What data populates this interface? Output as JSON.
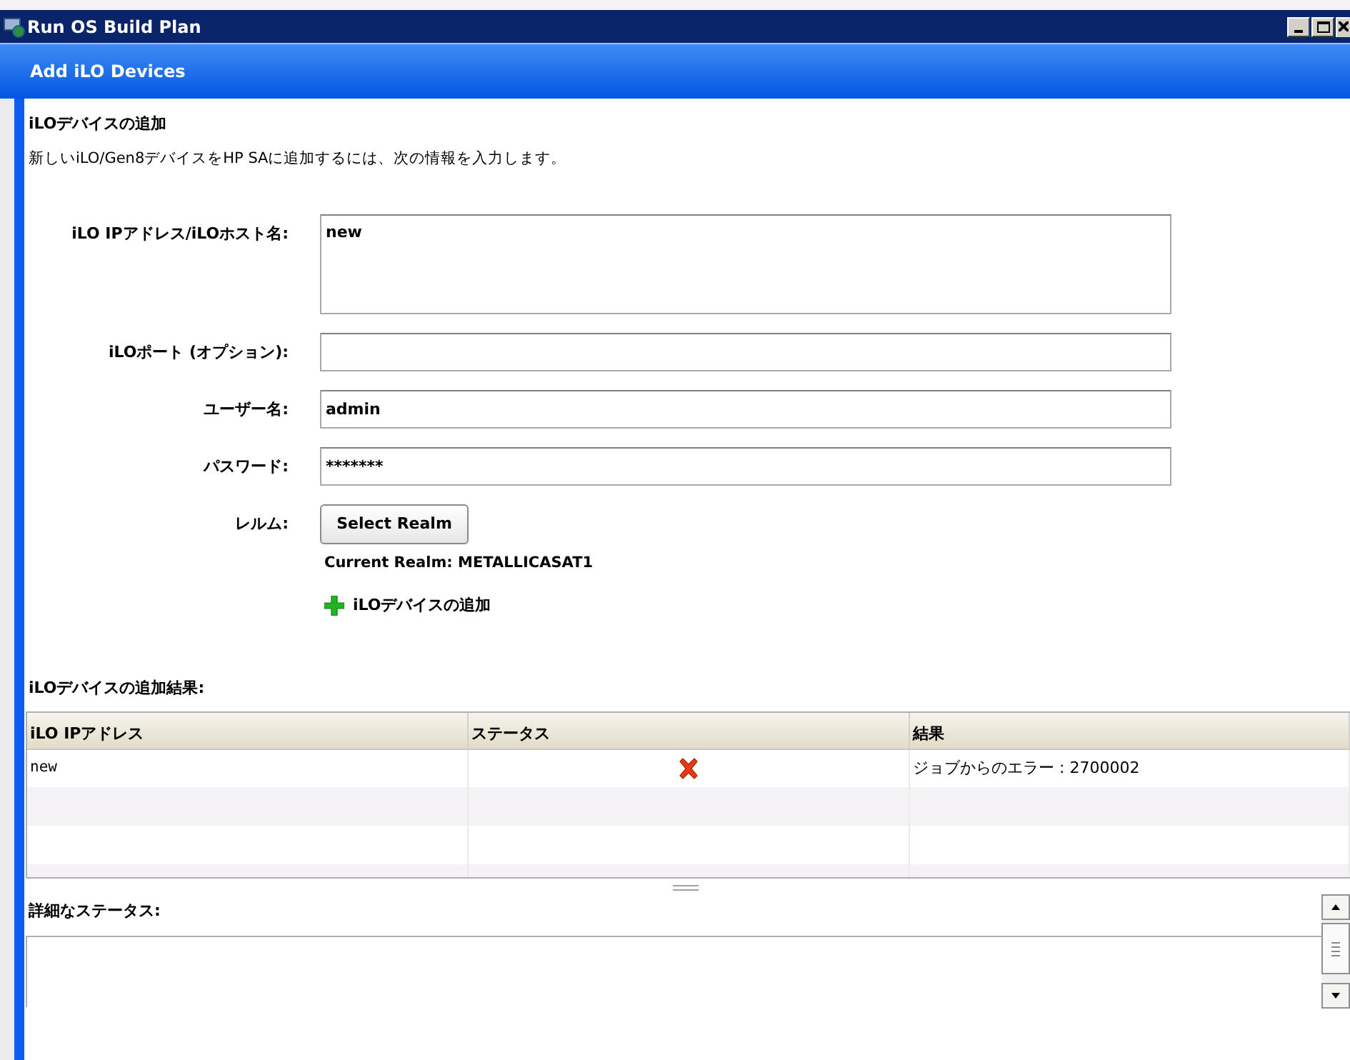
{
  "window": {
    "title": "Run OS Build Plan"
  },
  "header": {
    "title": "Add iLO Devices"
  },
  "section": {
    "title": "iLOデバイスの追加",
    "description": "新しいiLO/Gen8デバイスをHP SAに追加するには、次の情報を入力します。"
  },
  "form": [
    {
      "kind": "textarea",
      "label": "iLO IPアドレス/iLOホスト名:",
      "value": "new"
    },
    {
      "kind": "input",
      "label": "iLOポート (オプション):"
    },
    {
      "kind": "input",
      "label": "ユーザー名:",
      "value": "admin"
    },
    {
      "kind": "input",
      "label": "パスワード:",
      "value": "*******"
    },
    {
      "kind": "button",
      "label": "レルム:",
      "value": "Select Realm"
    }
  ],
  "current_realm": "Current Realm: METALLICASAT1",
  "add_link": "iLOデバイスの追加",
  "results": {
    "title": "iLOデバイスの追加結果:",
    "columns": [
      "iLO IPアドレス",
      "ステータス",
      "結果"
    ],
    "rows": [
      {
        "address": "new",
        "kind": "error",
        "result": "ジョブからのエラー : 2700002"
      }
    ]
  },
  "detail": {
    "label": "詳細なステータス:"
  }
}
